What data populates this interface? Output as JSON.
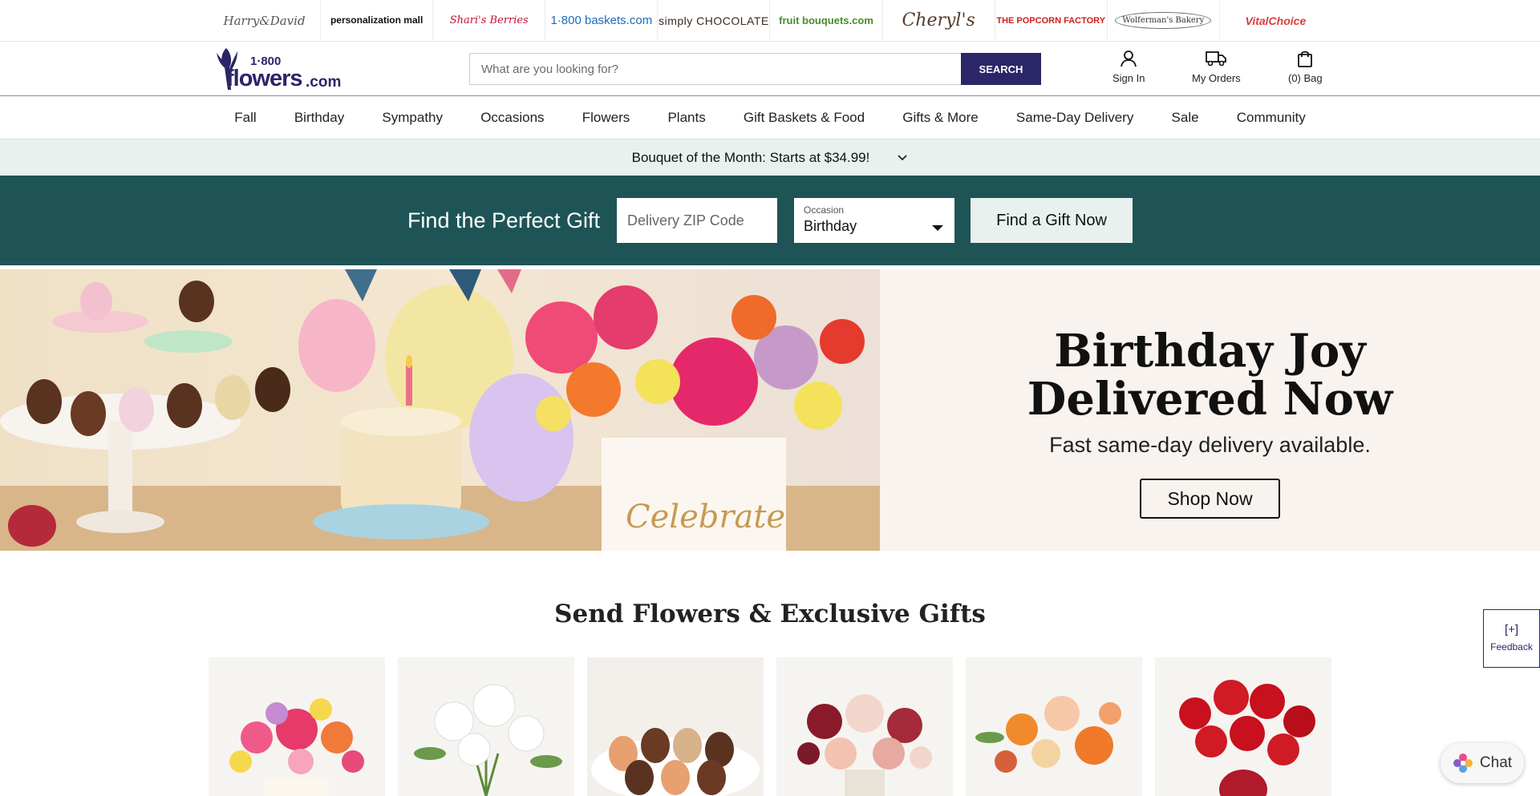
{
  "brands": [
    {
      "name": "Harry&David",
      "style": "b-script"
    },
    {
      "name": "personalization mall",
      "style": "b-bold"
    },
    {
      "name": "Shari's Berries",
      "style": "b-red"
    },
    {
      "name": "1·800 baskets.com",
      "style": "b-blue"
    },
    {
      "name": "simply CHOCOLATE",
      "style": "b-choc"
    },
    {
      "name": "fruit bouquets.com",
      "style": "b-green"
    },
    {
      "name": "Cheryl's",
      "style": "b-cheryl"
    },
    {
      "name": "THE POPCORN FACTORY",
      "style": "b-pop"
    },
    {
      "name": "Wolferman's Bakery",
      "style": "b-wolf"
    },
    {
      "name": "VitalChoice",
      "style": "b-vital"
    }
  ],
  "logo": {
    "line1": "1·800",
    "line2": "flowers",
    "line3": ".com"
  },
  "search": {
    "placeholder": "What are you looking for?",
    "button": "SEARCH"
  },
  "header_actions": {
    "sign_in": "Sign In",
    "orders": "My Orders",
    "bag": "(0) Bag"
  },
  "nav": [
    "Fall",
    "Birthday",
    "Sympathy",
    "Occasions",
    "Flowers",
    "Plants",
    "Gift Baskets & Food",
    "Gifts & More",
    "Same-Day Delivery",
    "Sale",
    "Community"
  ],
  "promo": {
    "text": "Bouquet of the Month: Starts at $34.99!"
  },
  "gift_finder": {
    "title": "Find the Perfect Gift",
    "zip_placeholder": "Delivery ZIP Code",
    "occasion_label": "Occasion",
    "occasion_value": "Birthday",
    "button": "Find a Gift Now"
  },
  "hero": {
    "heading_line1": "Birthday Joy",
    "heading_line2": "Delivered Now",
    "subheading": "Fast same-day delivery available.",
    "button": "Shop Now",
    "image_text": "Celebrate"
  },
  "section": {
    "title": "Send Flowers & Exclusive Gifts"
  },
  "products": [
    "bright-bouquet",
    "white-lilies",
    "chocolate-strawberries",
    "red-roses-mix",
    "orange-lilies",
    "red-roses-vase"
  ],
  "feedback": {
    "icon": "[+]",
    "label": "Feedback"
  },
  "chat": {
    "label": "Chat"
  },
  "colors": {
    "primary": "#2a2668",
    "teal": "#1f5457",
    "mint": "#e9f1ef",
    "hero_bg": "#f8f3ef"
  }
}
